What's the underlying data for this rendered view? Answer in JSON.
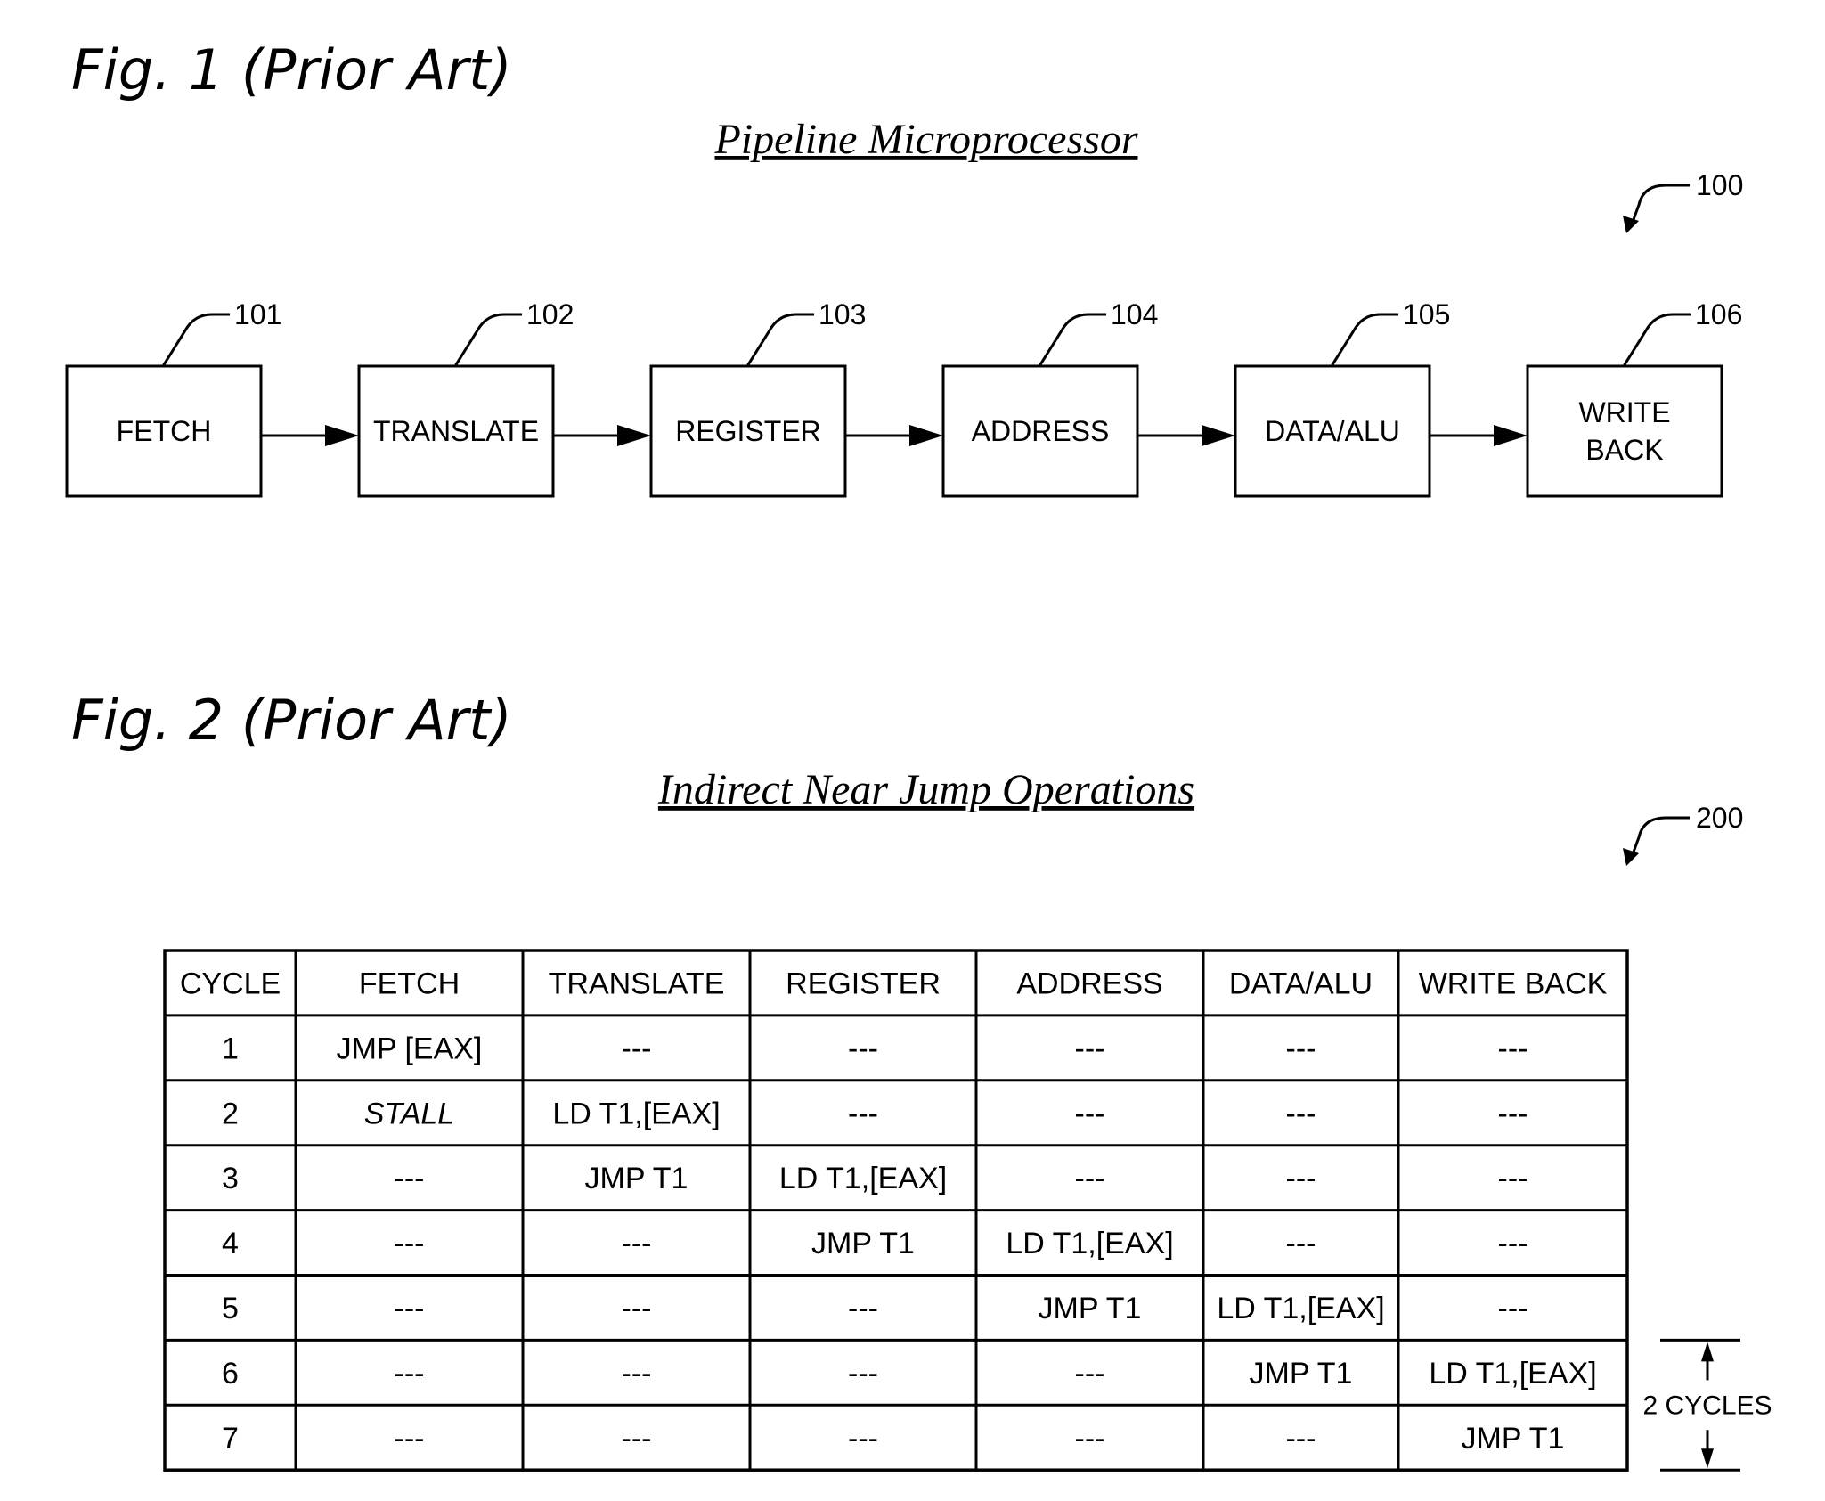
{
  "figure1": {
    "label": "Fig. 1 (Prior Art)",
    "title": "Pipeline Microprocessor",
    "ref": "100",
    "stages": [
      {
        "ref": "101",
        "lines": [
          "FETCH"
        ]
      },
      {
        "ref": "102",
        "lines": [
          "TRANSLATE"
        ]
      },
      {
        "ref": "103",
        "lines": [
          "REGISTER"
        ]
      },
      {
        "ref": "104",
        "lines": [
          "ADDRESS"
        ]
      },
      {
        "ref": "105",
        "lines": [
          "DATA/ALU"
        ]
      },
      {
        "ref": "106",
        "lines": [
          "WRITE",
          "BACK"
        ]
      }
    ]
  },
  "figure2": {
    "label": "Fig. 2 (Prior Art)",
    "title": "Indirect Near Jump Operations",
    "ref": "200",
    "table": {
      "headers": [
        "CYCLE",
        "FETCH",
        "TRANSLATE",
        "REGISTER",
        "ADDRESS",
        "DATA/ALU",
        "WRITE BACK"
      ],
      "rows": [
        [
          "1",
          "JMP [EAX]",
          "---",
          "---",
          "---",
          "---",
          "---"
        ],
        [
          "2",
          "STALL",
          "LD T1,[EAX]",
          "---",
          "---",
          "---",
          "---"
        ],
        [
          "3",
          "---",
          "JMP T1",
          "LD T1,[EAX]",
          "---",
          "---",
          "---"
        ],
        [
          "4",
          "---",
          "---",
          "JMP T1",
          "LD T1,[EAX]",
          "---",
          "---"
        ],
        [
          "5",
          "---",
          "---",
          "---",
          "JMP T1",
          "LD T1,[EAX]",
          "---"
        ],
        [
          "6",
          "---",
          "---",
          "---",
          "---",
          "JMP T1",
          "LD T1,[EAX]"
        ],
        [
          "7",
          "---",
          "---",
          "---",
          "---",
          "---",
          "JMP T1"
        ]
      ],
      "italic_cells": [
        [
          1,
          1
        ]
      ]
    },
    "annotation": {
      "label": "2 CYCLES",
      "from_row": 6,
      "to_row": 7
    }
  }
}
